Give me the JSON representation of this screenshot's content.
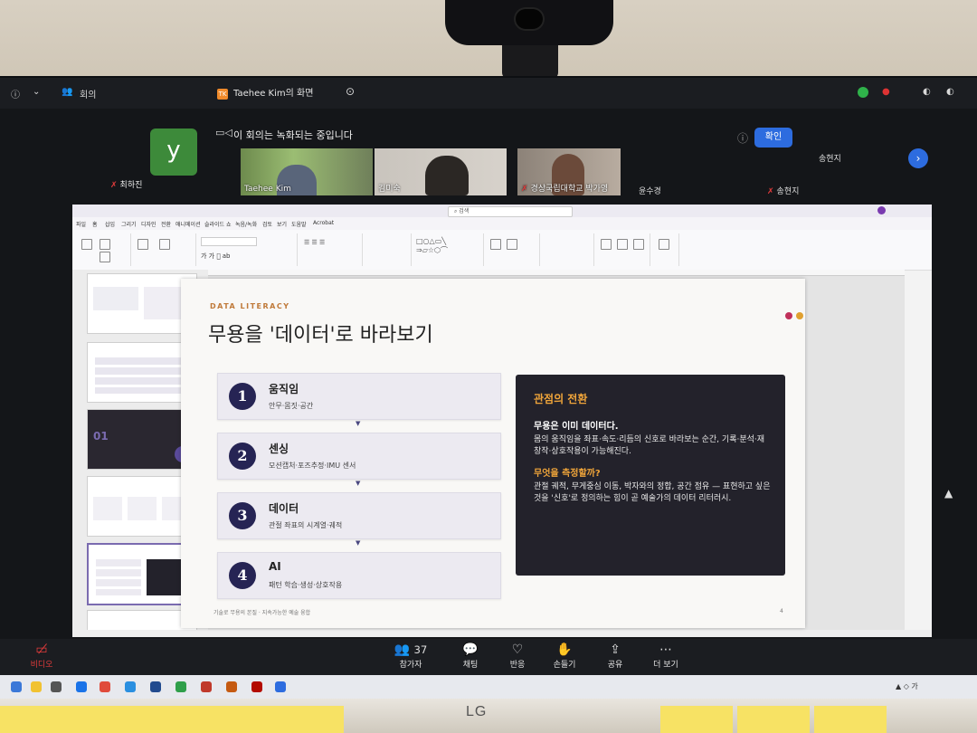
{
  "zoom": {
    "meeting_label": "회의",
    "share_label": "Taehee Kim의 화면",
    "recording_notice": "이 회의는 녹화되는 중입니다",
    "confirm_button": "확인",
    "participants": {
      "avatar_letter": "y",
      "p1": "최하진",
      "p2": "Taehee Kim",
      "p3": "김미숙",
      "p4": "경상국립대학교 박가영",
      "p5": "윤수경",
      "p6": "송현지",
      "p7": "송현지"
    },
    "toolbar": {
      "participants": "참가자",
      "participants_count": "37",
      "chat": "채팅",
      "react": "반응",
      "raise": "손들기",
      "share": "공유",
      "more": "더 보기",
      "left_label": "비디오"
    }
  },
  "ppt": {
    "search": "검색",
    "menu": [
      "파일",
      "홈",
      "삽입",
      "그리기",
      "디자인",
      "전환",
      "애니메이션",
      "슬라이드 쇼",
      "녹음/녹화",
      "검토",
      "보기",
      "도움말",
      "Acrobat"
    ]
  },
  "slide": {
    "kicker": "DATA LITERACY",
    "title": "무용을 '데이터'로 바라보기",
    "steps": [
      {
        "num": "1",
        "title": "움직임",
        "desc": "안무·몸짓·공간"
      },
      {
        "num": "2",
        "title": "센싱",
        "desc": "모션캡처·포즈추정·IMU 센서"
      },
      {
        "num": "3",
        "title": "데이터",
        "desc": "관절 좌표의 시계열·궤적"
      },
      {
        "num": "4",
        "title": "AI",
        "desc": "패턴 학습·생성·상호작용"
      }
    ],
    "card": {
      "heading": "관점의 전환",
      "bold": "무용은 이미 데이터다.",
      "para1": "몸의 움직임을 좌표·속도·리듬의 신호로 바라보는 순간, 기록·분석·재창작·상호작용이 가능해진다.",
      "question": "무엇을 측정할까?",
      "para2": "관절 궤적, 무게중심 이동, 박자와의 정합, 공간 점유 — 표현하고 싶은 것을 '신호'로 정의하는 힘이 곧 예술가의 데이터 리터러시."
    },
    "footer_left": "기술로 무용의 본질 · 지속가능한 예술 융합",
    "page_num": "4",
    "dot_colors": [
      "#c0305a",
      "#e0a030"
    ]
  },
  "monitor": {
    "brand": "LG"
  },
  "colors": {
    "navy": "#262454",
    "accent": "#f0a53a",
    "zoom_blue": "#2d6cdf"
  }
}
